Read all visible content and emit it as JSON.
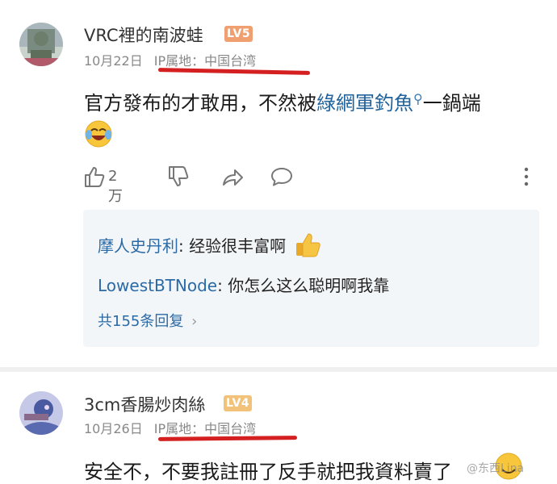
{
  "colors": {
    "link": "#22639c",
    "reply_user": "#2a6aa6",
    "meta_gray": "#888888",
    "highlight_red": "#d42020",
    "lv5_badge": "#f0a070",
    "lv4_badge": "#f2c17a",
    "reply_bg": "#f3f6f8"
  },
  "comments": [
    {
      "username": "VRC裡的南波蛙",
      "level_badge": "LV5",
      "date": "10月22日",
      "ip_label": "IP属地：",
      "ip_location": "中国台湾",
      "text_before_link": "官方發布的才敢用，不然被",
      "link_text": "綠網軍釣魚",
      "link_icon": "search-icon",
      "text_after_link": "一鍋端",
      "emoji": "laughing-crying-face",
      "like_count": "2万",
      "actions": [
        "like-icon",
        "dislike-icon",
        "share-icon",
        "comment-icon",
        "more-icon"
      ]
    },
    {
      "username": "3cm香腸炒肉絲",
      "level_badge": "LV4",
      "date": "10月26日",
      "ip_label": "IP属地：",
      "ip_location": "中国台湾",
      "text": "安全不，不要我註冊了反手就把我資料賣了",
      "emoji": "smiling-face"
    }
  ],
  "replies": {
    "items": [
      {
        "user": "摩人史丹利",
        "text": ": 经验很丰富啊",
        "emoji": "thumbs-up"
      },
      {
        "user": "LowestBTNode",
        "text": ": 你怎么这么聪明啊我靠"
      }
    ],
    "more_label": "共155条回复",
    "more_chevron": "›"
  },
  "watermark": "@东西Lina"
}
